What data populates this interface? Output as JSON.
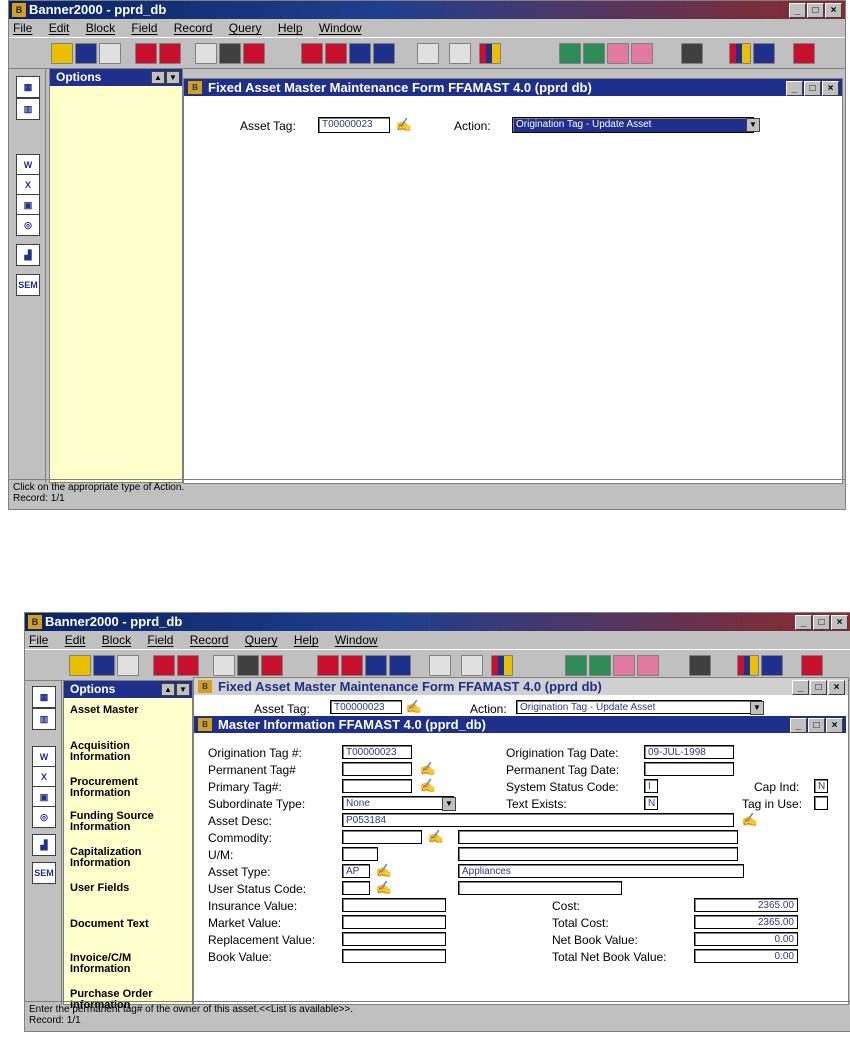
{
  "screen1": {
    "app_title": "Banner2000 - pprd_db",
    "menu": [
      "File",
      "Edit",
      "Block",
      "Field",
      "Record",
      "Query",
      "Help",
      "Window"
    ],
    "options_title": "Options",
    "form_title": "Fixed  Asset Master Maintenance Form  FFAMAST  4.0  (pprd  db)",
    "asset_tag_label": "Asset Tag:",
    "asset_tag_value": "T00000023",
    "action_label": "Action:",
    "action_value": "Origination Tag - Update Asset",
    "status_line1": "Click on the appropriate type of Action.",
    "status_line2": "Record: 1/1"
  },
  "screen2": {
    "app_title": "Banner2000 - pprd_db",
    "menu": [
      "File",
      "Edit",
      "Block",
      "Field",
      "Record",
      "Query",
      "Help",
      "Window"
    ],
    "options_title": "Options",
    "options_items": [
      "Asset Master",
      "Acquisition Information",
      "Procurement Information",
      "Funding Source Information",
      "Capitalization Information",
      "User Fields",
      "Document Text",
      "Invoice/C/M Information",
      "Purchase Order Information"
    ],
    "form_title": "Fixed  Asset Master Maintenance Form  FFAMAST  4.0  (pprd  db)",
    "asset_tag_label": "Asset Tag:",
    "asset_tag_value": "T00000023",
    "action_label": "Action:",
    "action_value": "Origination Tag - Update Asset",
    "sub_title": "Master Information  FFAMAST  4.0  (pprd_db)",
    "fields": {
      "orig_tag_label": "Origination Tag #:",
      "orig_tag_value": "T00000023",
      "perm_tag_label": "Permanent Tag#",
      "primary_tag_label": "Primary Tag#:",
      "subordinate_label": "Subordinate Type:",
      "subordinate_value": "None",
      "asset_desc_label": "Asset Desc:",
      "asset_desc_value": "P053184",
      "commodity_label": "Commodity:",
      "um_label": "U/M:",
      "asset_type_label": "Asset Type:",
      "asset_type_code": "AP",
      "asset_type_desc": "Appliances",
      "user_status_label": "User Status Code:",
      "insurance_label": "Insurance Value:",
      "market_label": "Market Value:",
      "replacement_label": "Replacement Value:",
      "book_label": "Book Value:",
      "orig_date_label": "Origination Tag Date:",
      "orig_date_value": "09-JUL-1998",
      "perm_date_label": "Permanent Tag Date:",
      "system_status_label": "System Status Code:",
      "system_status_value": "I",
      "cap_ind_label": "Cap Ind:",
      "cap_ind_value": "N",
      "text_exists_label": "Text Exists:",
      "text_exists_value": "N",
      "tag_in_use_label": "Tag in Use:",
      "cost_label": "Cost:",
      "cost_value": "2365.00",
      "total_cost_label": "Total Cost:",
      "total_cost_value": "2365.00",
      "nbv_label": "Net Book Value:",
      "nbv_value": "0.00",
      "total_nbv_label": "Total Net Book Value:",
      "total_nbv_value": "0.00"
    },
    "status_line1": "Enter the permanent tag# of the owner of this asset.<<List is available>>.",
    "status_line2": "Record: 1/1"
  }
}
